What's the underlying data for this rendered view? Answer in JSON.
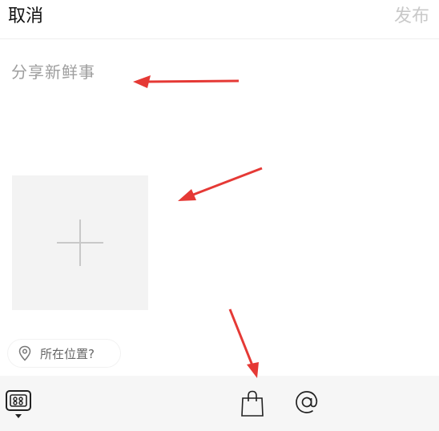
{
  "header": {
    "cancel_label": "取消",
    "publish_label": "发布"
  },
  "compose": {
    "placeholder": "分享新鲜事"
  },
  "media": {
    "add_icon": "plus-icon"
  },
  "location": {
    "label": "所在位置?",
    "icon": "location-pin-icon"
  },
  "toolbar": {
    "items": [
      "photo-album-icon",
      "shopping-bag-icon",
      "at-mention-icon"
    ]
  },
  "colors": {
    "annotation_arrow": "#e53935",
    "publish_disabled": "#c9c9c9",
    "toolbar_bg": "#f6f6f6"
  }
}
